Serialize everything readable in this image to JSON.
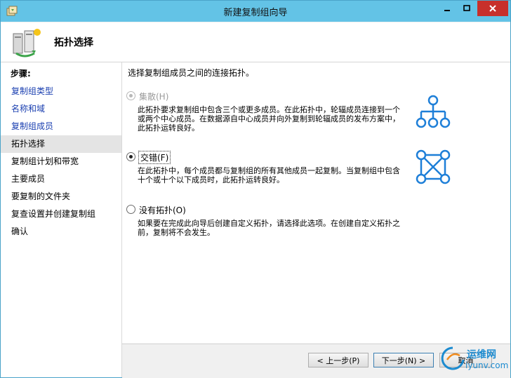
{
  "window": {
    "title": "新建复制组向导",
    "icon": "replication-wizard-icon",
    "controls": [
      "minimize-icon",
      "maximize-icon",
      "close-icon"
    ]
  },
  "header": {
    "title": "拓扑选择",
    "icon": "server-replication-icon"
  },
  "steps": {
    "heading": "步骤:",
    "items": [
      {
        "label": "复制组类型",
        "state": "link"
      },
      {
        "label": "名称和域",
        "state": "link"
      },
      {
        "label": "复制组成员",
        "state": "link"
      },
      {
        "label": "拓扑选择",
        "state": "current"
      },
      {
        "label": "复制组计划和带宽",
        "state": "plain"
      },
      {
        "label": "主要成员",
        "state": "plain"
      },
      {
        "label": "要复制的文件夹",
        "state": "plain"
      },
      {
        "label": "复查设置并创建复制组",
        "state": "plain"
      },
      {
        "label": "确认",
        "state": "plain"
      }
    ]
  },
  "content": {
    "intro": "选择复制组成员之间的连接拓扑。",
    "options": [
      {
        "label": "集散(H)",
        "enabled": false,
        "selected": false,
        "description": "此拓扑要求复制组中包含三个或更多成员。在此拓扑中，轮辐成员连接到一个或两个中心成员。在数据源自中心成员并向外复制到轮辐成员的发布方案中，此拓扑运转良好。",
        "icon": "hub-spoke-topology-icon"
      },
      {
        "label": "交错(F)",
        "enabled": true,
        "selected": true,
        "description": "在此拓扑中，每个成员都与复制组的所有其他成员一起复制。当复制组中包含十个或十个以下成员时，此拓扑运转良好。",
        "icon": "full-mesh-topology-icon"
      },
      {
        "label": "没有拓扑(O)",
        "enabled": true,
        "selected": false,
        "description": "如果要在完成此向导后创建自定义拓扑，请选择此选项。在创建自定义拓扑之前，复制将不会发生。",
        "icon": null
      }
    ]
  },
  "footer": {
    "back_label": "< 上一步(P)",
    "next_label": "下一步(N) >",
    "cancel_label": "取消"
  },
  "watermark": {
    "line1": "运维网",
    "line2": "iyunv.com"
  },
  "colors": {
    "titlebar": "#63c3e6",
    "close_button": "#c7302b",
    "link": "#1a3fb0",
    "topology_icon": "#1e7fd8",
    "watermark": "#1c8bd0"
  }
}
